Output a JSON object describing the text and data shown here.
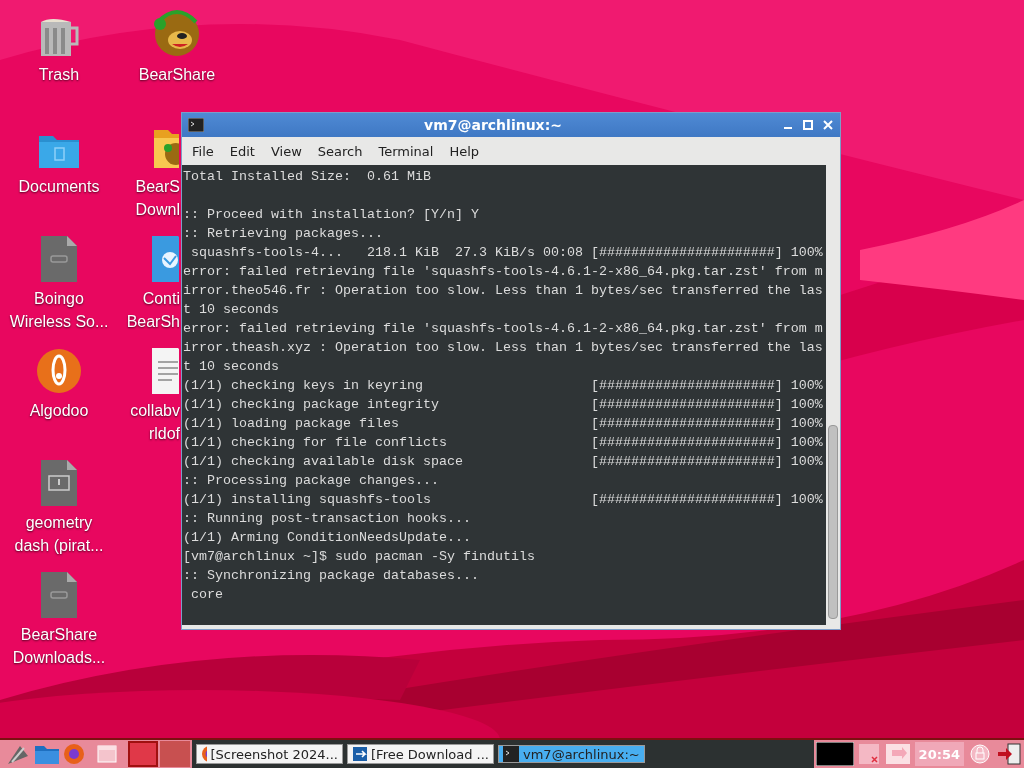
{
  "desktop_icons": [
    {
      "kind": "trash",
      "lines": [
        "Trash"
      ]
    },
    {
      "kind": "folder",
      "lines": [
        "Documents"
      ]
    },
    {
      "kind": "file",
      "lines": [
        "Boingo",
        "Wireless So..."
      ]
    },
    {
      "kind": "algodoo",
      "lines": [
        "Algodoo"
      ]
    },
    {
      "kind": "exec",
      "lines": [
        "geometry",
        "dash (pirat..."
      ]
    },
    {
      "kind": "file",
      "lines": [
        "BearShare",
        "Downloads..."
      ]
    },
    {
      "kind": "bear",
      "lines": [
        "BearShare"
      ]
    },
    {
      "kind": "bearfolder",
      "lines": [
        "BearS",
        "Downl"
      ]
    },
    {
      "kind": "web",
      "lines": [
        "Conti",
        "BearSh"
      ]
    },
    {
      "kind": "text",
      "lines": [
        "collabv",
        "rldof"
      ]
    }
  ],
  "window": {
    "title": "vm7@archlinux:~",
    "menu": [
      "File",
      "Edit",
      "View",
      "Search",
      "Terminal",
      "Help"
    ],
    "paragraphs": [
      [
        "Total Installed Size:  0.61 MiB"
      ],
      [
        ":: Proceed with installation? [Y/n] Y",
        ":: Retrieving packages...",
        " squashfs-tools-4...   218.1 KiB  27.3 KiB/s 00:08 [######################] 100%",
        "error: failed retrieving file 'squashfs-tools-4.6.1-2-x86_64.pkg.tar.zst' from m",
        "irror.theo546.fr : Operation too slow. Less than 1 bytes/sec transferred the las",
        "t 10 seconds",
        "error: failed retrieving file 'squashfs-tools-4.6.1-2-x86_64.pkg.tar.zst' from m",
        "irror.theash.xyz : Operation too slow. Less than 1 bytes/sec transferred the las",
        "t 10 seconds",
        "(1/1) checking keys in keyring                     [######################] 100%",
        "(1/1) checking package integrity                   [######################] 100%",
        "(1/1) loading package files                        [######################] 100%",
        "(1/1) checking for file conflicts                  [######################] 100%",
        "(1/1) checking available disk space                [######################] 100%",
        ":: Processing package changes...",
        "(1/1) installing squashfs-tools                    [######################] 100%",
        ":: Running post-transaction hooks...",
        "(1/1) Arming ConditionNeedsUpdate...",
        "[vm7@archlinux ~]$ sudo pacman -Sy findutils",
        ":: Synchronizing package databases...",
        " core"
      ]
    ]
  },
  "taskbar": {
    "workspaces": [
      {
        "selected": true
      },
      {
        "selected": false
      }
    ],
    "tasks": [
      {
        "kind": "firefox",
        "label": "[Screenshot 2024...",
        "selected": false
      },
      {
        "kind": "download",
        "label": "[Free Download ...",
        "selected": false
      },
      {
        "kind": "terminal",
        "label": "vm7@archlinux:~",
        "selected": true
      }
    ],
    "clock": "20:54"
  }
}
